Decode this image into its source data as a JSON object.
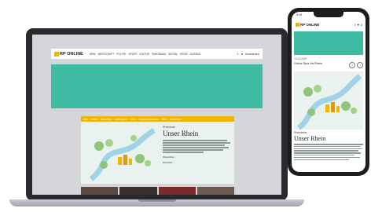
{
  "laptop": {
    "site": {
      "logo": "RP ONLINE",
      "nav": [
        "NRW",
        "WIRTSCHAFT",
        "POLITIK",
        "SPORT",
        "KULTUR",
        "PANORAMA",
        "DIGITAL",
        "REISE",
        "GUSSAG"
      ],
      "login": "Anmelden"
    },
    "subnav": [
      "RRM",
      "Städte",
      "Bewertung",
      "Leadinggrün",
      "Fimes",
      "Bewertungsberichte",
      "Reise",
      "Mitrbeitbeit"
    ],
    "article": {
      "kicker": "Rheinbote",
      "headline": "Unser Rhein",
      "bullets": [
        "Rheindörfer: ... ",
        "Rheinfeld: ..."
      ]
    }
  },
  "phone": {
    "status": "9:41",
    "logo": "RP ONLINE",
    "meta": "19.12.2019",
    "meta_sub": "Grüne Spur für Rhein",
    "kicker": "Rheinfelde",
    "headline": "Unser Rhein"
  },
  "colors": {
    "accent_yellow": "#f2b600",
    "banner_teal": "#3dbba3",
    "river_blue": "#9fd3e8"
  }
}
